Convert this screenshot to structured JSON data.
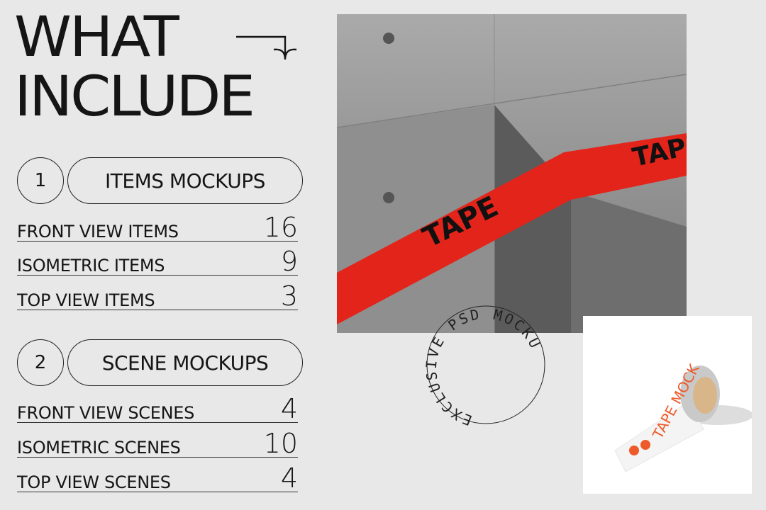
{
  "title": {
    "line1": "WHAT",
    "line2": "INCLUDE",
    "arrow_icon": "arrow-right-down-icon"
  },
  "sections": [
    {
      "number": "1",
      "label": "ITEMS MOCKUPS",
      "rows": [
        {
          "label": "FRONT VIEW ITEMS",
          "count": "16"
        },
        {
          "label": "ISOMETRIC ITEMS",
          "count": "9"
        },
        {
          "label": "TOP VIEW ITEMS",
          "count": "3"
        }
      ]
    },
    {
      "number": "2",
      "label": "SCENE MOCKUPS",
      "rows": [
        {
          "label": "FRONT VIEW SCENES",
          "count": "4"
        },
        {
          "label": "ISOMETRIC SCENES",
          "count": "10"
        },
        {
          "label": "TOP VIEW SCENES",
          "count": "4"
        }
      ]
    }
  ],
  "photo": {
    "tape_text": "TAPE",
    "tape_color": "#e3241b"
  },
  "stamp": {
    "text": "EXCLUSIVE PSD MOCKU"
  },
  "product": {
    "tape_text": "TAPE MOCK",
    "accent": "#ee5a2a"
  }
}
